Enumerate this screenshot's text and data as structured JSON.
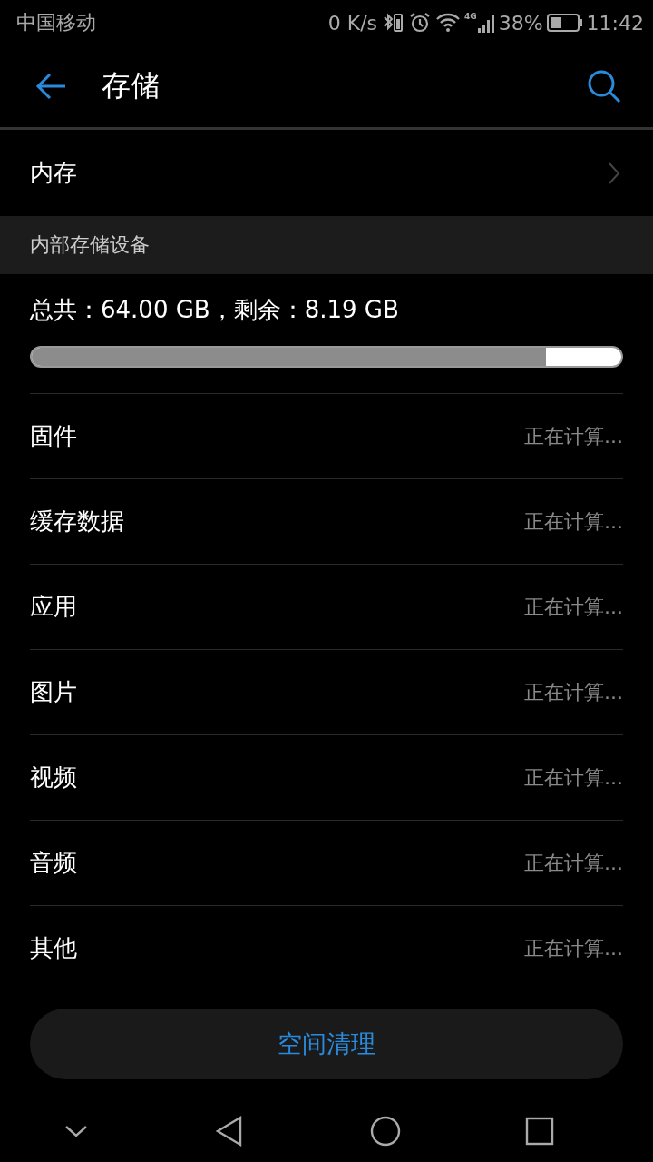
{
  "status_bar": {
    "carrier": "中国移动",
    "speed": "0 K/s",
    "network": "4G",
    "battery": "38%",
    "time": "11:42"
  },
  "toolbar": {
    "title": "存储"
  },
  "memory_row": {
    "label": "内存"
  },
  "section": {
    "title": "内部存储设备"
  },
  "storage": {
    "summary": "总共：64.00 GB，剩余：8.19 GB",
    "level": 0.872
  },
  "categories": [
    {
      "label": "固件",
      "value": "正在计算..."
    },
    {
      "label": "缓存数据",
      "value": "正在计算..."
    },
    {
      "label": "应用",
      "value": "正在计算..."
    },
    {
      "label": "图片",
      "value": "正在计算..."
    },
    {
      "label": "视频",
      "value": "正在计算..."
    },
    {
      "label": "音频",
      "value": "正在计算..."
    },
    {
      "label": "其他",
      "value": "正在计算..."
    }
  ],
  "clean_button": {
    "label": "空间清理"
  }
}
